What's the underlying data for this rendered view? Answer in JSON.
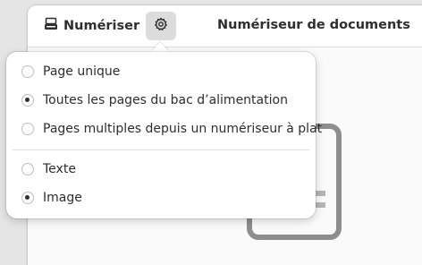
{
  "header": {
    "scan_label": "Numériser",
    "scan_icon": "scanner-icon",
    "settings_icon": "gear-icon",
    "title": "Numériseur de documents"
  },
  "popover": {
    "page_options": [
      {
        "label": "Page unique",
        "checked": false
      },
      {
        "label": "Toutes les pages du bac d’alimentation",
        "checked": true
      },
      {
        "label": "Pages multiples depuis un numériseur à plat",
        "checked": false
      }
    ],
    "type_options": [
      {
        "label": "Texte",
        "checked": false
      },
      {
        "label": "Image",
        "checked": true
      }
    ]
  },
  "colors": {
    "headerbar": "#ffffff",
    "window": "#fafafa",
    "accent_button": "#dcdcdc",
    "text": "#2e2e2e"
  }
}
